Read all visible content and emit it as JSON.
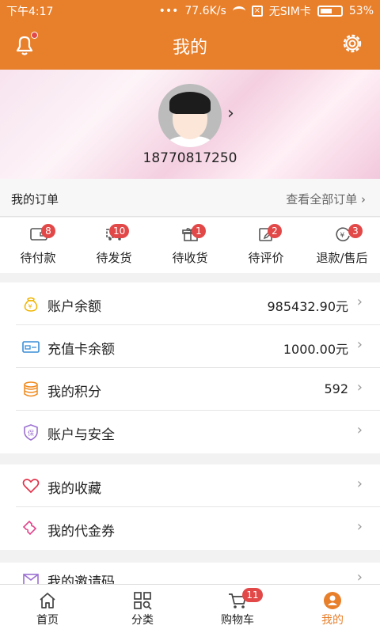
{
  "status": {
    "time": "下午4:17",
    "speed": "77.6K/s",
    "sim": "无SIM卡",
    "battery": "53%"
  },
  "header": {
    "title": "我的"
  },
  "profile": {
    "phone": "18770817250"
  },
  "orders": {
    "label": "我的订单",
    "view_all": "查看全部订单",
    "items": [
      {
        "label": "待付款",
        "count": "8",
        "icon": "wallet-icon"
      },
      {
        "label": "待发货",
        "count": "10",
        "icon": "truck-icon"
      },
      {
        "label": "待收货",
        "count": "1",
        "icon": "gift-icon"
      },
      {
        "label": "待评价",
        "count": "2",
        "icon": "edit-icon"
      },
      {
        "label": "退款/售后",
        "count": "3",
        "icon": "refund-icon"
      }
    ]
  },
  "account": {
    "balance": {
      "label": "账户余额",
      "value": "985432.90元"
    },
    "card": {
      "label": "充值卡余额",
      "value": "1000.00元"
    },
    "points": {
      "label": "我的积分",
      "value": "592"
    },
    "security": {
      "label": "账户与安全"
    }
  },
  "favorites": {
    "collect": {
      "label": "我的收藏"
    },
    "voucher": {
      "label": "我的代金券"
    }
  },
  "invite": {
    "label": "我的邀请码"
  },
  "nav": {
    "home": "首页",
    "category": "分类",
    "cart": "购物车",
    "cart_count": "11",
    "mine": "我的"
  },
  "colors": {
    "accent": "#e87f2b",
    "badge": "#e24848"
  }
}
